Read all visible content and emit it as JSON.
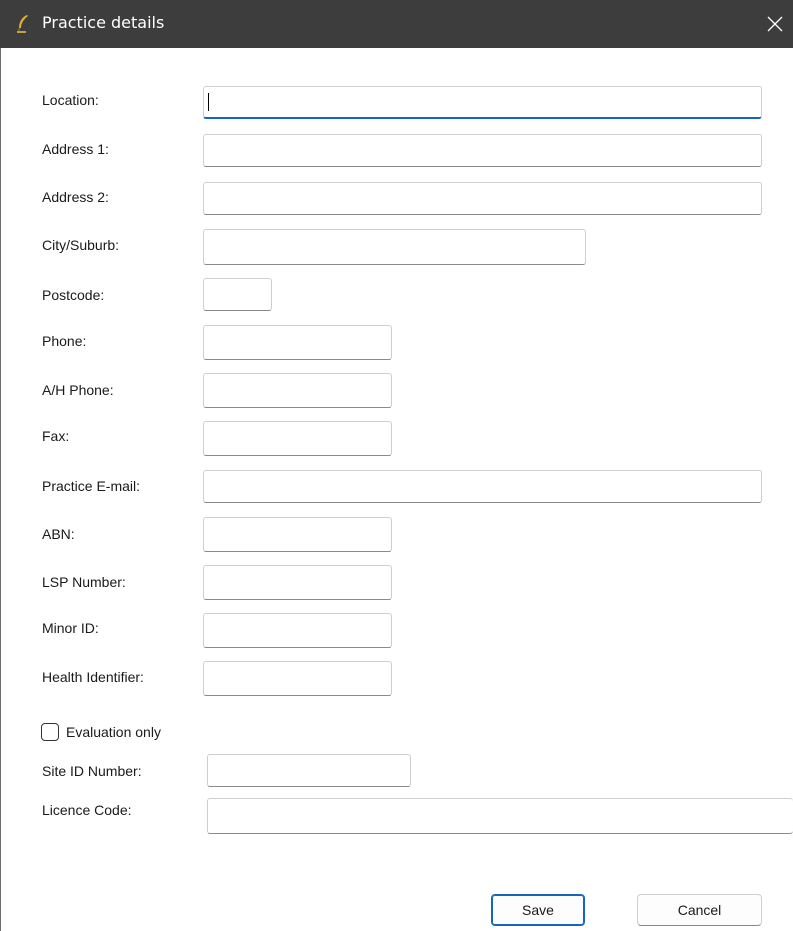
{
  "window": {
    "title": "Practice details",
    "icon": "app-quill-icon",
    "close": "close-icon"
  },
  "form": {
    "fields": [
      {
        "name": "location",
        "label": "Location:",
        "value": "",
        "focused": true
      },
      {
        "name": "address1",
        "label": "Address 1:",
        "value": ""
      },
      {
        "name": "address2",
        "label": "Address 2:",
        "value": ""
      },
      {
        "name": "city",
        "label": "City/Suburb:",
        "value": ""
      },
      {
        "name": "postcode",
        "label": "Postcode:",
        "value": ""
      },
      {
        "name": "phone",
        "label": "Phone:",
        "value": ""
      },
      {
        "name": "ah-phone",
        "label": "A/H Phone:",
        "value": ""
      },
      {
        "name": "fax",
        "label": "Fax:",
        "value": ""
      },
      {
        "name": "email",
        "label": "Practice E-mail:",
        "value": ""
      },
      {
        "name": "abn",
        "label": "ABN:",
        "value": ""
      },
      {
        "name": "lsp",
        "label": "LSP Number:",
        "value": ""
      },
      {
        "name": "minor-id",
        "label": "Minor ID:",
        "value": ""
      },
      {
        "name": "health-id",
        "label": "Health Identifier:",
        "value": ""
      }
    ],
    "evaluation_only": {
      "label": "Evaluation only",
      "checked": false
    },
    "site_id": {
      "label": "Site ID Number:",
      "value": ""
    },
    "licence_code": {
      "label": "Licence Code:",
      "value": ""
    }
  },
  "buttons": {
    "save": "Save",
    "cancel": "Cancel"
  }
}
